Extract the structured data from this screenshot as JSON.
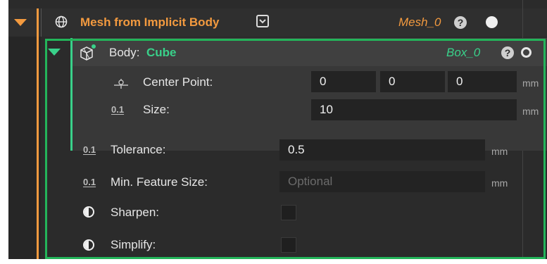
{
  "root": {
    "title": "Mesh from Implicit Body",
    "id": "Mesh_0",
    "help": "?"
  },
  "body": {
    "label": "Body:",
    "value": "Cube",
    "id": "Box_0",
    "help": "?",
    "center_point": {
      "label": "Center Point:",
      "values": [
        "0",
        "0",
        "0"
      ],
      "unit": "mm"
    },
    "size": {
      "icon_text": "0.1",
      "label": "Size:",
      "value": "10",
      "unit": "mm"
    }
  },
  "params": {
    "tolerance": {
      "icon_text": "0.1",
      "label": "Tolerance:",
      "value": "0.5",
      "unit": "mm"
    },
    "min_feature": {
      "icon_text": "0.1",
      "label": "Min. Feature Size:",
      "placeholder": "Optional",
      "unit": "mm"
    },
    "sharpen": {
      "label": "Sharpen:"
    },
    "simplify": {
      "label": "Simplify:"
    }
  },
  "colors": {
    "accent_orange": "#f39a3f",
    "accent_green": "#39d18a",
    "frame_green": "#23b55a"
  }
}
